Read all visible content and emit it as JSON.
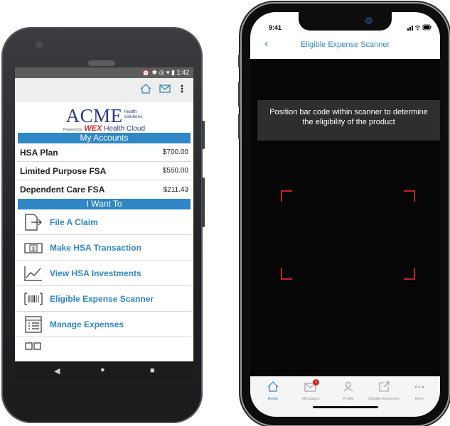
{
  "android": {
    "status_time": "1:42",
    "company_name": "ACME",
    "company_tagline_1": "health",
    "company_tagline_2": "solutions",
    "powered_by": "Powered by",
    "wex_text": "WEX",
    "wex_suffix": "Health Cloud",
    "accounts_header": "My Accounts",
    "accounts": [
      {
        "name": "HSA Plan",
        "amount": "$700.00"
      },
      {
        "name": "Limited Purpose FSA",
        "amount": "$550.00"
      },
      {
        "name": "Dependent Care FSA",
        "amount": "$211.43"
      }
    ],
    "want_header": "I Want To",
    "actions": [
      {
        "label": "File A Claim",
        "icon": "file-claim-icon"
      },
      {
        "label": "Make HSA Transaction",
        "icon": "dollar-bill-icon"
      },
      {
        "label": "View HSA Investments",
        "icon": "line-chart-icon"
      },
      {
        "label": "Eligible Expense Scanner",
        "icon": "barcode-icon"
      },
      {
        "label": "Manage Expenses",
        "icon": "expense-list-icon"
      }
    ]
  },
  "iphone": {
    "time": "9:41",
    "title": "Eligible Expense Scanner",
    "instruction_line1": "Position bar code within scanner to determine",
    "instruction_line2": "the eligibility of the product",
    "tabs": [
      {
        "label": "Home",
        "icon": "home-icon",
        "active": true
      },
      {
        "label": "Messages",
        "icon": "mail-icon",
        "badge": "1"
      },
      {
        "label": "Profile",
        "icon": "person-icon"
      },
      {
        "label": "Eligible Expenses",
        "icon": "external-link-icon"
      },
      {
        "label": "More",
        "icon": "more-icon"
      }
    ]
  },
  "colors": {
    "accent": "#2f87c5",
    "brand_navy": "#2b3a87",
    "wex_red": "#cf2a2f",
    "scanner_red": "#c9201f"
  }
}
